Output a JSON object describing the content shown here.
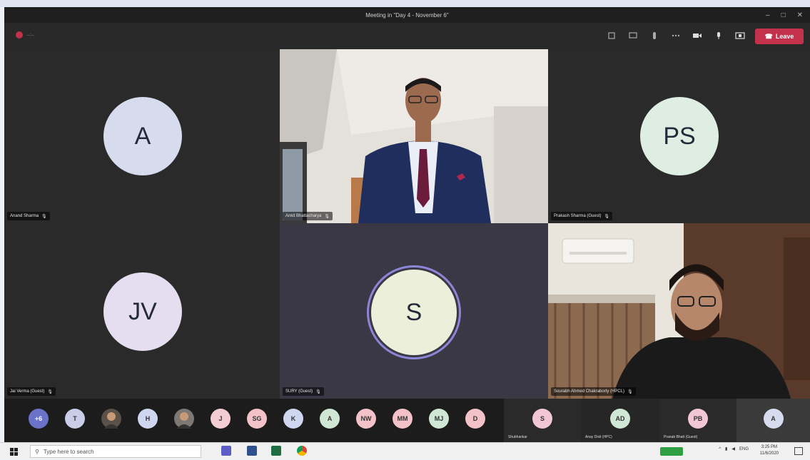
{
  "window": {
    "title": "Meeting in \"Day 4 - November 6\"",
    "min": "–",
    "max": "□",
    "close": "✕"
  },
  "toolbar": {
    "leave_label": "Leave",
    "timer": "–:–"
  },
  "tiles": [
    {
      "kind": "avatar",
      "initials": "A",
      "name": "Anand Sharma",
      "bg": "#2b2a2a",
      "avatar_bg": "#d6dcee"
    },
    {
      "kind": "video",
      "name": "Ankit Bhattacharya"
    },
    {
      "kind": "avatar",
      "initials": "PS",
      "name": "Prakash Sharma (Guest)",
      "bg": "#2b2a2a",
      "avatar_bg": "#dfeee3"
    },
    {
      "kind": "avatar",
      "initials": "JV",
      "name": "Jai Verma (Guest)",
      "bg": "#2b2a2a",
      "avatar_bg": "#e4def0"
    },
    {
      "kind": "avatar",
      "initials": "S",
      "name": "SURY (Guest)",
      "bg": "#3a3845",
      "avatar_bg": "#ecefd9"
    },
    {
      "kind": "video",
      "name": "Sourabh Ahmed Chakraborty (HPCL)"
    }
  ],
  "strip": {
    "chips": [
      {
        "text": "+6",
        "bg": "#6b72c9",
        "fg": "#fff"
      },
      {
        "text": "T",
        "bg": "#c9cde8",
        "fg": "#333"
      },
      {
        "text": "",
        "bg": "#5a5248",
        "fg": "#fff",
        "photo": true
      },
      {
        "text": "H",
        "bg": "#cfd6f0",
        "fg": "#333"
      },
      {
        "text": "",
        "bg": "#7d7873",
        "fg": "#fff",
        "photo": true
      },
      {
        "text": "J",
        "bg": "#f4cdd4",
        "fg": "#333"
      },
      {
        "text": "SG",
        "bg": "#f2c2c8",
        "fg": "#333"
      },
      {
        "text": "K",
        "bg": "#cfd6f0",
        "fg": "#333"
      },
      {
        "text": "A",
        "bg": "#cfe7d4",
        "fg": "#333"
      },
      {
        "text": "NW",
        "bg": "#f2c2c8",
        "fg": "#333"
      },
      {
        "text": "MM",
        "bg": "#f2c2c8",
        "fg": "#333"
      },
      {
        "text": "MJ",
        "bg": "#cfe7d4",
        "fg": "#333"
      },
      {
        "text": "D",
        "bg": "#f2c2c8",
        "fg": "#333"
      }
    ],
    "big": [
      {
        "text": "S",
        "label": "Shubhankar",
        "bg": "#f3c6d6"
      },
      {
        "text": "AD",
        "label": "Anay Dixit (HPC)",
        "bg": "#cfe7d4"
      },
      {
        "text": "PB",
        "label": "Pranab Bhatt (Guest)",
        "bg": "#f3c6d6"
      },
      {
        "text": "A",
        "label": "",
        "bg": "#d6dcee"
      }
    ]
  },
  "taskbar": {
    "search_placeholder": "Type here to search",
    "time": "3:25 PM",
    "date": "11/6/2020",
    "lang": "ENG"
  }
}
